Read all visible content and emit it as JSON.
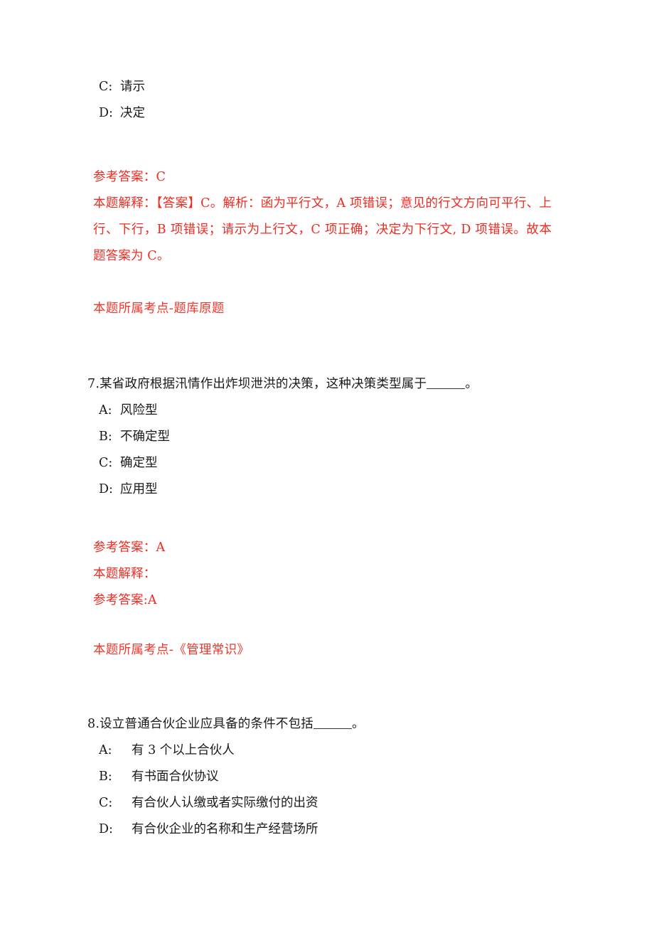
{
  "document": {
    "page_background": "#ffffff",
    "body_text_color": "#1a1a1a",
    "answer_text_color": "#ef2b22",
    "kaodian_text_color": "#f4362c"
  },
  "question6_tail": {
    "options": [
      {
        "label": "C:",
        "text": "请示"
      },
      {
        "label": "D:",
        "text": "决定"
      }
    ],
    "answer_label": "参考答案：C",
    "explanation": "本题解释：【答案】C。解析：函为平行文，A 项错误；意见的行文方向可平行、上行、下行，B 项错误；请示为上行文，C 项正确；决定为下行文, D 项错误。故本题答案为 C。",
    "kaodian": "本题所属考点-题库原题"
  },
  "question7": {
    "number": "7.",
    "stem_before_blank": "某省政府根据汛情作出炸坝泄洪的决策，这种决策类型属于",
    "stem_after_blank": "。",
    "options": [
      {
        "label": "A:",
        "text": "风险型"
      },
      {
        "label": "B:",
        "text": "不确定型"
      },
      {
        "label": "C:",
        "text": "确定型"
      },
      {
        "label": "D:",
        "text": "应用型"
      }
    ],
    "answer_label": "参考答案：A",
    "explanation_label": "本题解释：",
    "answer_repeat": "参考答案:A",
    "kaodian": "本题所属考点-《管理常识》"
  },
  "question8": {
    "number": "8.",
    "stem_before_blank": "设立普通合伙企业应具备的条件不包括",
    "stem_after_blank": "。",
    "options": [
      {
        "label": "A:",
        "text": "有 3 个以上合伙人"
      },
      {
        "label": "B:",
        "text": "有书面合伙协议"
      },
      {
        "label": "C:",
        "text": "有合伙人认缴或者实际缴付的出资"
      },
      {
        "label": "D:",
        "text": "有合伙企业的名称和生产经营场所"
      }
    ]
  }
}
